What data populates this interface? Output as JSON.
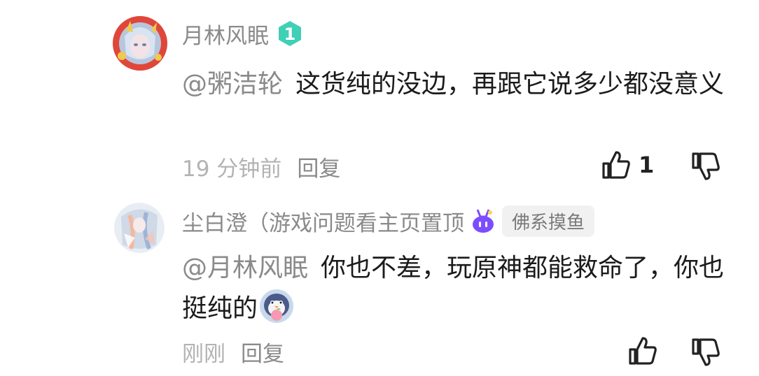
{
  "comments": [
    {
      "username": "月林风眠",
      "level_badge": "1",
      "mention": "@粥洁轮",
      "text": "这货纯的没边，再跟它说多少都没意义",
      "timestamp": "19 分钟前",
      "reply_label": "回复",
      "like_count": "1",
      "avatar_icon": "anime-girl-avatar-with-red-frame",
      "colors": {
        "level_badge": "#3fd0b6",
        "frame": "#e0463a"
      }
    },
    {
      "username": "尘白澄（游戏问题看主页置顶",
      "vip_icon": "purple-bunny-vip-icon",
      "tag": "佛系摸鱼",
      "mention": "@月林风眠",
      "text": "你也不差，玩原神都能救命了，你也挺纯的",
      "emoji": "penguin-holding-peach-emoji",
      "timestamp": "刚刚",
      "reply_label": "回复",
      "avatar_icon": "anime-character-avatar",
      "colors": {
        "vip_icon": "#7c4dff"
      }
    }
  ]
}
